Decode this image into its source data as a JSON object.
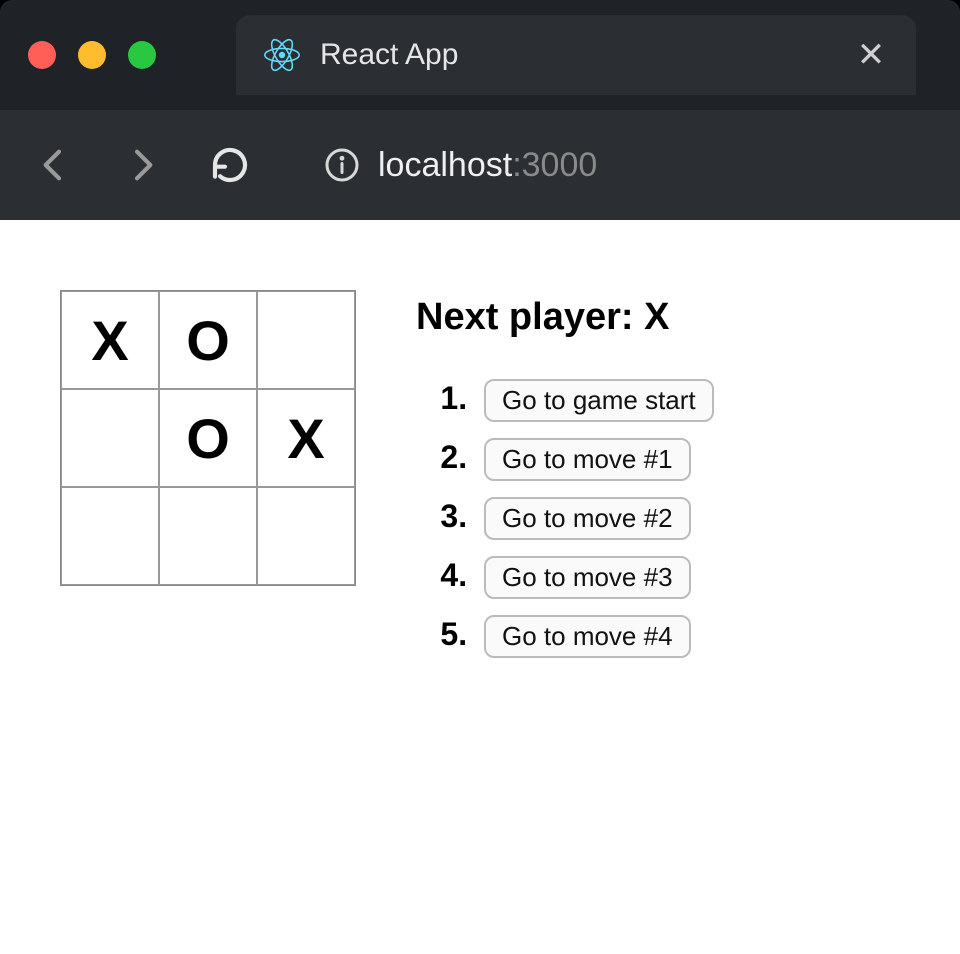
{
  "browser": {
    "tab_title": "React App",
    "url_host": "localhost",
    "url_port": ":3000"
  },
  "game": {
    "status": "Next player: X",
    "board": [
      "X",
      "O",
      "",
      "",
      "O",
      "X",
      "",
      "",
      ""
    ],
    "history": [
      {
        "label": "Go to game start"
      },
      {
        "label": "Go to move #1"
      },
      {
        "label": "Go to move #2"
      },
      {
        "label": "Go to move #3"
      },
      {
        "label": "Go to move #4"
      }
    ]
  }
}
